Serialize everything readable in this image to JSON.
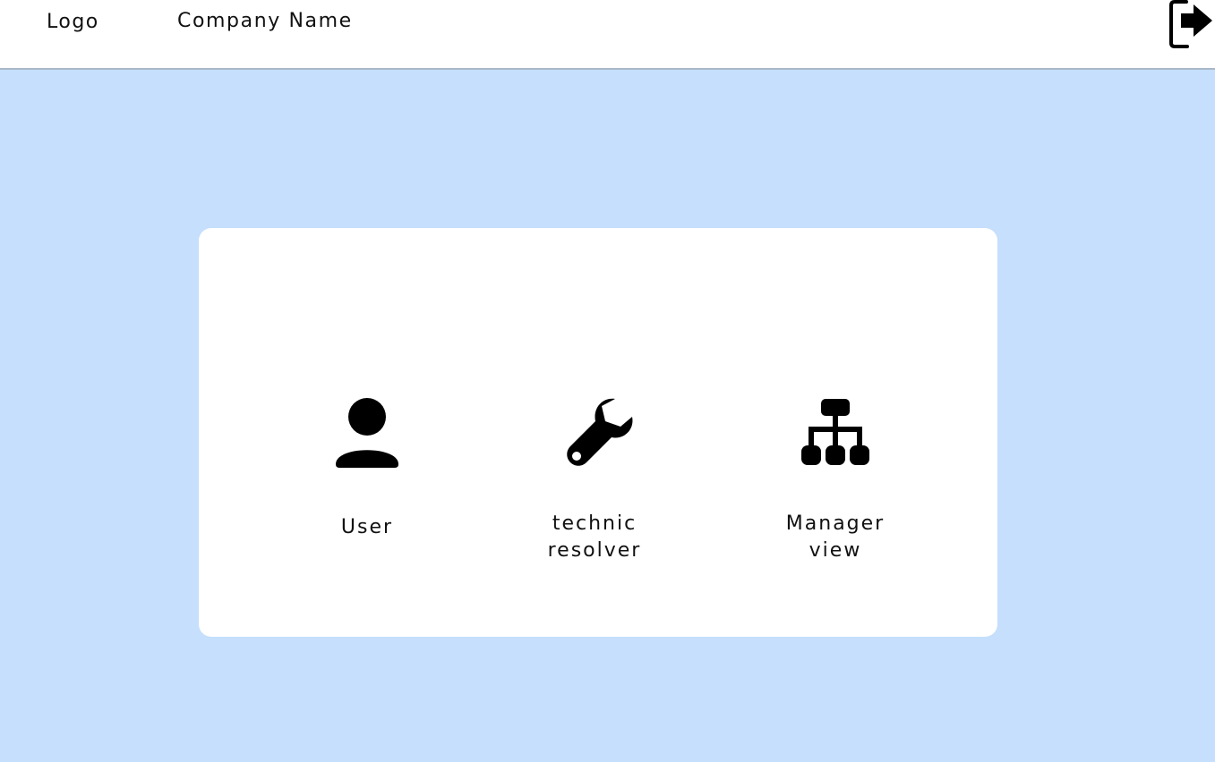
{
  "header": {
    "logo": "Logo",
    "company_name": "Company Name",
    "logout_icon": "logout-icon"
  },
  "main": {
    "roles": [
      {
        "label": "User",
        "icon": "user-icon"
      },
      {
        "label": "technic\nresolver",
        "icon": "wrench-icon"
      },
      {
        "label": "Manager\nview",
        "icon": "org-chart-icon"
      }
    ]
  },
  "theme": {
    "background": "#c5dffc",
    "surface": "#ffffff",
    "icon_color": "#000000",
    "header_border": "#a9b8c7"
  }
}
